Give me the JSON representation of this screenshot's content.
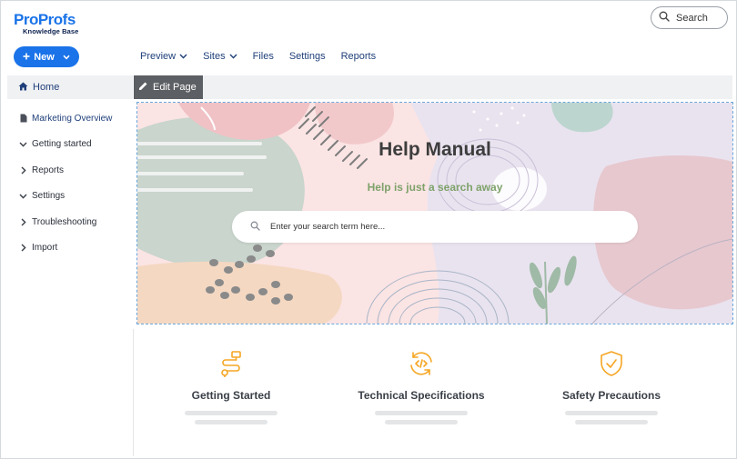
{
  "logo": {
    "brand_pro": "Pro",
    "brand_profs": "Profs",
    "subtitle": "Knowledge Base"
  },
  "search": {
    "label": "Search",
    "icon": "search-icon"
  },
  "new_button": {
    "label": "New",
    "icon": "plus-icon"
  },
  "topnav": [
    {
      "label": "Preview",
      "has_dropdown": true
    },
    {
      "label": "Sites",
      "has_dropdown": true
    },
    {
      "label": "Files",
      "has_dropdown": false
    },
    {
      "label": "Settings",
      "has_dropdown": false
    },
    {
      "label": "Reports",
      "has_dropdown": false
    }
  ],
  "sidebar": {
    "home": {
      "label": "Home",
      "icon": "home-icon"
    },
    "items": [
      {
        "label": "Marketing Overview",
        "icon": "document-icon",
        "state": "page"
      },
      {
        "label": "Getting started",
        "icon": "chevron-down-icon",
        "state": "expanded"
      },
      {
        "label": "Reports",
        "icon": "chevron-right-icon",
        "state": "collapsed"
      },
      {
        "label": "Settings",
        "icon": "chevron-down-icon",
        "state": "expanded"
      },
      {
        "label": "Troubleshooting",
        "icon": "chevron-right-icon",
        "state": "collapsed"
      },
      {
        "label": "Import",
        "icon": "chevron-right-icon",
        "state": "collapsed"
      }
    ]
  },
  "editor": {
    "edit_page_label": "Edit Page",
    "icon": "pencil-icon"
  },
  "hero": {
    "title": "Help Manual",
    "subtitle": "Help is just a search away",
    "search_placeholder": "Enter your search term here..."
  },
  "cards": [
    {
      "title": "Getting Started",
      "icon": "route-icon"
    },
    {
      "title": "Technical Specifications",
      "icon": "code-sync-icon"
    },
    {
      "title": "Safety Precautions",
      "icon": "shield-check-icon"
    }
  ],
  "colors": {
    "primary": "#1a73e8",
    "nav_text": "#1f3f7a",
    "accent_orange": "#f5a623",
    "hero_green": "#7ea26a",
    "edit_button_bg": "#5c5f63"
  }
}
